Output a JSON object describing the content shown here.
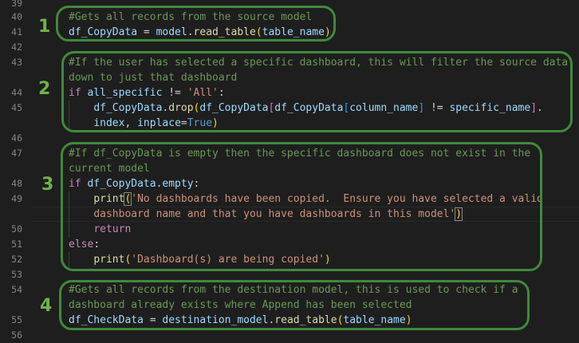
{
  "line_numbers": [
    "39",
    "40",
    "41",
    "42",
    "43",
    "",
    "44",
    "45",
    "46",
    "47",
    "",
    "48",
    "49",
    "",
    "50",
    "51",
    "52",
    "53",
    "54",
    "",
    "55",
    "56"
  ],
  "annotations": [
    "1",
    "2",
    "3",
    "4"
  ],
  "code": {
    "l40": "#Gets all records from the source model",
    "l41": {
      "a": "df_CopyData",
      "b": " = ",
      "c": "model",
      "d": ".",
      "e": "read_table",
      "f": "(",
      "g": "table_name",
      "h": ")"
    },
    "l43a": "#If the user has selected a specific dashboard, this will filter the source data",
    "l43b": "down to just that dashboard",
    "l44": {
      "kw": "if",
      "v1": "all_specific",
      "op": " != ",
      "s": "'All'",
      "c": ":"
    },
    "l45a": {
      "v": "df_CopyData",
      "d": ".",
      "fn": "drop",
      "p1": "(",
      "v2": "df_CopyData",
      "b1": "[",
      "v3": "df_CopyData",
      "b2": "[",
      "v4": "column_name",
      "b3": "]",
      "op": " != ",
      "v5": "specific_name",
      "b4": "]",
      "dot": "."
    },
    "l45b": {
      "v": "index",
      "c": ", ",
      "v2": "inplace",
      "eq": "=",
      "cst": "True",
      "p": ")"
    },
    "l47a": "#If df_CopyData is empty then the specific dashboard does not exist in the",
    "l47b": "current model",
    "l48": {
      "kw": "if",
      "v": "df_CopyData",
      "d": ".",
      "v2": "empty",
      "c": ":"
    },
    "l49a": {
      "fn": "print",
      "p": "(",
      "s": "'No dashboards have been copied.  Ensure you have selected a valid"
    },
    "l49b": {
      "s": "dashboard name and that you have dashboards in this model'",
      "p": ")"
    },
    "l50": "return",
    "l51": "else",
    "l51c": ":",
    "l52": {
      "fn": "print",
      "p": "(",
      "s": "'Dashboard(s) are being copied'",
      "p2": ")"
    },
    "l54a": "#Gets all records from the destination model, this is used to check if a",
    "l54b": "dashboard already exists where Append has been selected",
    "l55": {
      "a": "df_CheckData",
      "b": " = ",
      "c": "destination_model",
      "d": ".",
      "e": "read_table",
      "f": "(",
      "g": "table_name",
      "h": ")"
    }
  },
  "colors": {
    "background": "#1e1e1e",
    "comment": "#6a9955",
    "keyword": "#c586c0",
    "variable": "#9cdcfe",
    "function": "#dcdcaa",
    "string": "#ce9178",
    "constant": "#569cd6",
    "annotation_green": "#3f8a3a"
  }
}
